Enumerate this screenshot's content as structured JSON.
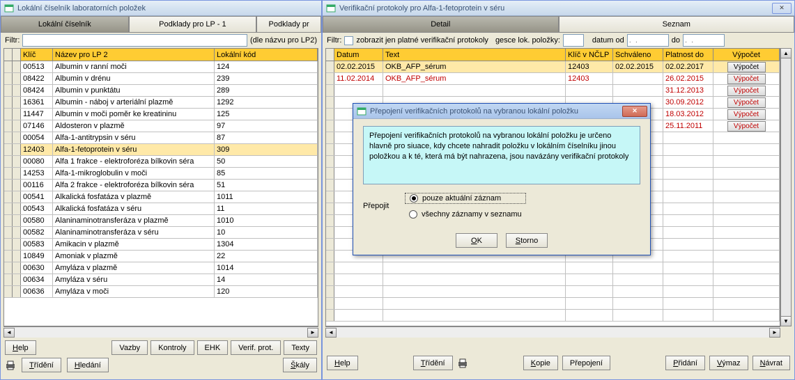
{
  "left_window": {
    "title": "Lokální číselník laboratorních položek",
    "tabs": [
      "Lokální číselník",
      "Podklady pro LP - 1",
      "Podklady pr"
    ],
    "filter_label": "Filtr:",
    "filter_hint": "(dle názvu pro LP2)",
    "headers": [
      "Klíč",
      "Název pro LP 2",
      "Lokální kód"
    ],
    "rows": [
      {
        "k": "00513",
        "n": "Albumin v ranní moči",
        "l": "124"
      },
      {
        "k": "08422",
        "n": "Albumin v drénu",
        "l": "239"
      },
      {
        "k": "08424",
        "n": "Albumin v punktátu",
        "l": "289"
      },
      {
        "k": "16361",
        "n": "Albumin - náboj v arteriální plazmě",
        "l": "1292"
      },
      {
        "k": "11447",
        "n": "Albumin v moči poměr ke kreatininu",
        "l": "125"
      },
      {
        "k": "07146",
        "n": "Aldosteron v plazmě",
        "l": "97"
      },
      {
        "k": "00054",
        "n": "Alfa-1-antitrypsin v séru",
        "l": "87"
      },
      {
        "k": "12403",
        "n": "Alfa-1-fetoprotein v séru",
        "l": "309",
        "sel": true
      },
      {
        "k": "00080",
        "n": "Alfa 1 frakce - elektroforéza bílkovin séra",
        "l": "50"
      },
      {
        "k": "14253",
        "n": "Alfa-1-mikroglobulin v moči",
        "l": "85"
      },
      {
        "k": "00116",
        "n": "Alfa 2 frakce - elektroforéza bílkovin séra",
        "l": "51"
      },
      {
        "k": "00541",
        "n": "Alkalická fosfatáza v plazmě",
        "l": "1011"
      },
      {
        "k": "00543",
        "n": "Alkalická fosfatáza v séru",
        "l": "11"
      },
      {
        "k": "00580",
        "n": "Alaninaminotransferáza v plazmě",
        "l": "1010"
      },
      {
        "k": "00582",
        "n": "Alaninaminotransferáza v séru",
        "l": "10"
      },
      {
        "k": "00583",
        "n": "Amikacin v plazmě",
        "l": "1304"
      },
      {
        "k": "10849",
        "n": "Amoniak v plazmě",
        "l": "22"
      },
      {
        "k": "00630",
        "n": "Amyláza v plazmě",
        "l": "1014"
      },
      {
        "k": "00634",
        "n": "Amyláza v séru",
        "l": "14"
      },
      {
        "k": "00636",
        "n": "Amyláza v moči",
        "l": "120"
      }
    ],
    "buttons": {
      "help": "Help",
      "vazby": "Vazby",
      "kontroly": "Kontroly",
      "ehk": "EHK",
      "verif": "Verif. prot.",
      "texty": "Texty",
      "trideni": "Třídění",
      "hledani": "Hledání",
      "skaly": "Škály"
    }
  },
  "right_window": {
    "title": "Verifikační protokoly pro Alfa-1-fetoprotein v séru",
    "tabs": [
      "Detail",
      "Seznam"
    ],
    "filter_label": "Filtr:",
    "chk_label": "zobrazit jen platné verifikační protokoly",
    "gesce_label": "gesce lok. položky:",
    "datum_od": "datum od",
    "do": "do",
    "date_placeholder": ".  .",
    "headers": [
      "Datum",
      "Text",
      "Klíč v NČLP",
      "Schváleno",
      "Platnost do",
      "Výpočet"
    ],
    "rows": [
      {
        "d": "02.02.2015",
        "t": "OKB_AFP_sérum",
        "k": "12403",
        "s": "02.02.2015",
        "p": "02.02.2017",
        "sel": true
      },
      {
        "d": "11.02.2014",
        "t": "OKB_AFP_sérum",
        "k": "12403",
        "s": "",
        "p": "26.02.2015",
        "red": true
      },
      {
        "d": "",
        "t": "",
        "k": "",
        "s": "",
        "p": "31.12.2013",
        "red": true
      },
      {
        "d": "",
        "t": "",
        "k": "",
        "s": ".  .",
        "p": "30.09.2012",
        "red": true
      },
      {
        "d": "",
        "t": "",
        "k": "",
        "s": ".  .",
        "p": "18.03.2012",
        "red": true
      },
      {
        "d": "",
        "t": "",
        "k": "",
        "s": ".  .",
        "p": "25.11.2011",
        "red": true
      }
    ],
    "vypocet_label": "Výpočet",
    "buttons": {
      "help": "Help",
      "trideni": "Třídění",
      "kopie": "Kopie",
      "prepojeni": "Přepojení",
      "pridani": "Přidání",
      "vymaz": "Výmaz",
      "navrat": "Návrat"
    }
  },
  "dialog": {
    "title": "Přepojení verifikačních protokolů na vybranou lokální položku",
    "info": "Přepojení verifikačních protokolů na vybranou lokální položku je určeno hlavně pro siuace, kdy chcete nahradit položku v lokálním číselníku jinou položkou a k té, která má být nahrazena, jsou navázány verifikační protokoly",
    "prepojit_label": "Přepojit",
    "opt1": "pouze aktuální záznam",
    "opt2": "všechny záznamy v seznamu",
    "ok": "OK",
    "storno": "Storno"
  }
}
